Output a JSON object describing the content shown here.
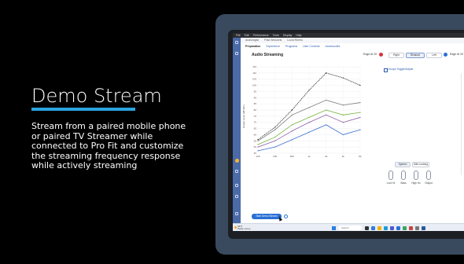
{
  "slide": {
    "title": "Demo Stream",
    "description": "Stream from a paired mobile phone or paired TV Streamer while connected to Pro Fit and customize the streaming frequency response while actively streaming",
    "accent_color": "#2aa3df"
  },
  "app": {
    "menu": [
      "File",
      "Edit",
      "Performance",
      "Tools",
      "Display",
      "Help"
    ],
    "toolbar": [
      "Audiologist",
      "Past Sessions",
      "Lucia Rivera"
    ],
    "tabs": [
      "Preparation",
      "Experience",
      "Programs",
      "User Controls",
      "Accessories"
    ],
    "section_title": "Audio Streaming",
    "ear_select": {
      "left_label": "Edge AI 20",
      "right_label": "Right",
      "both_label": "Binaural",
      "left_btn": "Left",
      "right_device": "Edge AI 20"
    },
    "group_label": "Groups Toggle/Adjust",
    "controls": {
      "speech_btn": "Speech",
      "music_btn": "Mild Looking",
      "knobs": [
        "Low Hz",
        "Bass",
        "High Hz",
        "Output"
      ]
    },
    "stream_button": "Start Demo Stream",
    "taskbar": {
      "weather_temp": "64°F",
      "weather_text": "Partly sunny",
      "search_placeholder": "Search"
    }
  },
  "chart_data": {
    "type": "line",
    "x": [
      "125",
      "250",
      "500",
      "1k",
      "2k",
      "4k",
      "8k"
    ],
    "ylabel": "Output Level (dB SPL)",
    "y_ticks": [
      "115",
      "110",
      "105",
      "100",
      "95",
      "90",
      "85",
      "80",
      "75",
      "70",
      "65",
      "60",
      "55",
      "50",
      "45"
    ],
    "series": [
      {
        "color": "#111111",
        "style": "dotted",
        "values": [
          56,
          66,
          80,
          96,
          110,
          106,
          100
        ]
      },
      {
        "color": "#7d7d7d",
        "style": "solid",
        "values": [
          55,
          64,
          76,
          82,
          88,
          84,
          86
        ]
      },
      {
        "color": "#74b23c",
        "style": "solid",
        "values": [
          52,
          58,
          68,
          74,
          80,
          76,
          78
        ]
      },
      {
        "color": "#8a5ea8",
        "style": "solid",
        "values": [
          50,
          55,
          63,
          70,
          76,
          70,
          74
        ]
      },
      {
        "color": "#3a6fd0",
        "style": "solid",
        "values": [
          47,
          50,
          56,
          62,
          68,
          60,
          64
        ]
      }
    ],
    "ylim": [
      45,
      115
    ]
  }
}
